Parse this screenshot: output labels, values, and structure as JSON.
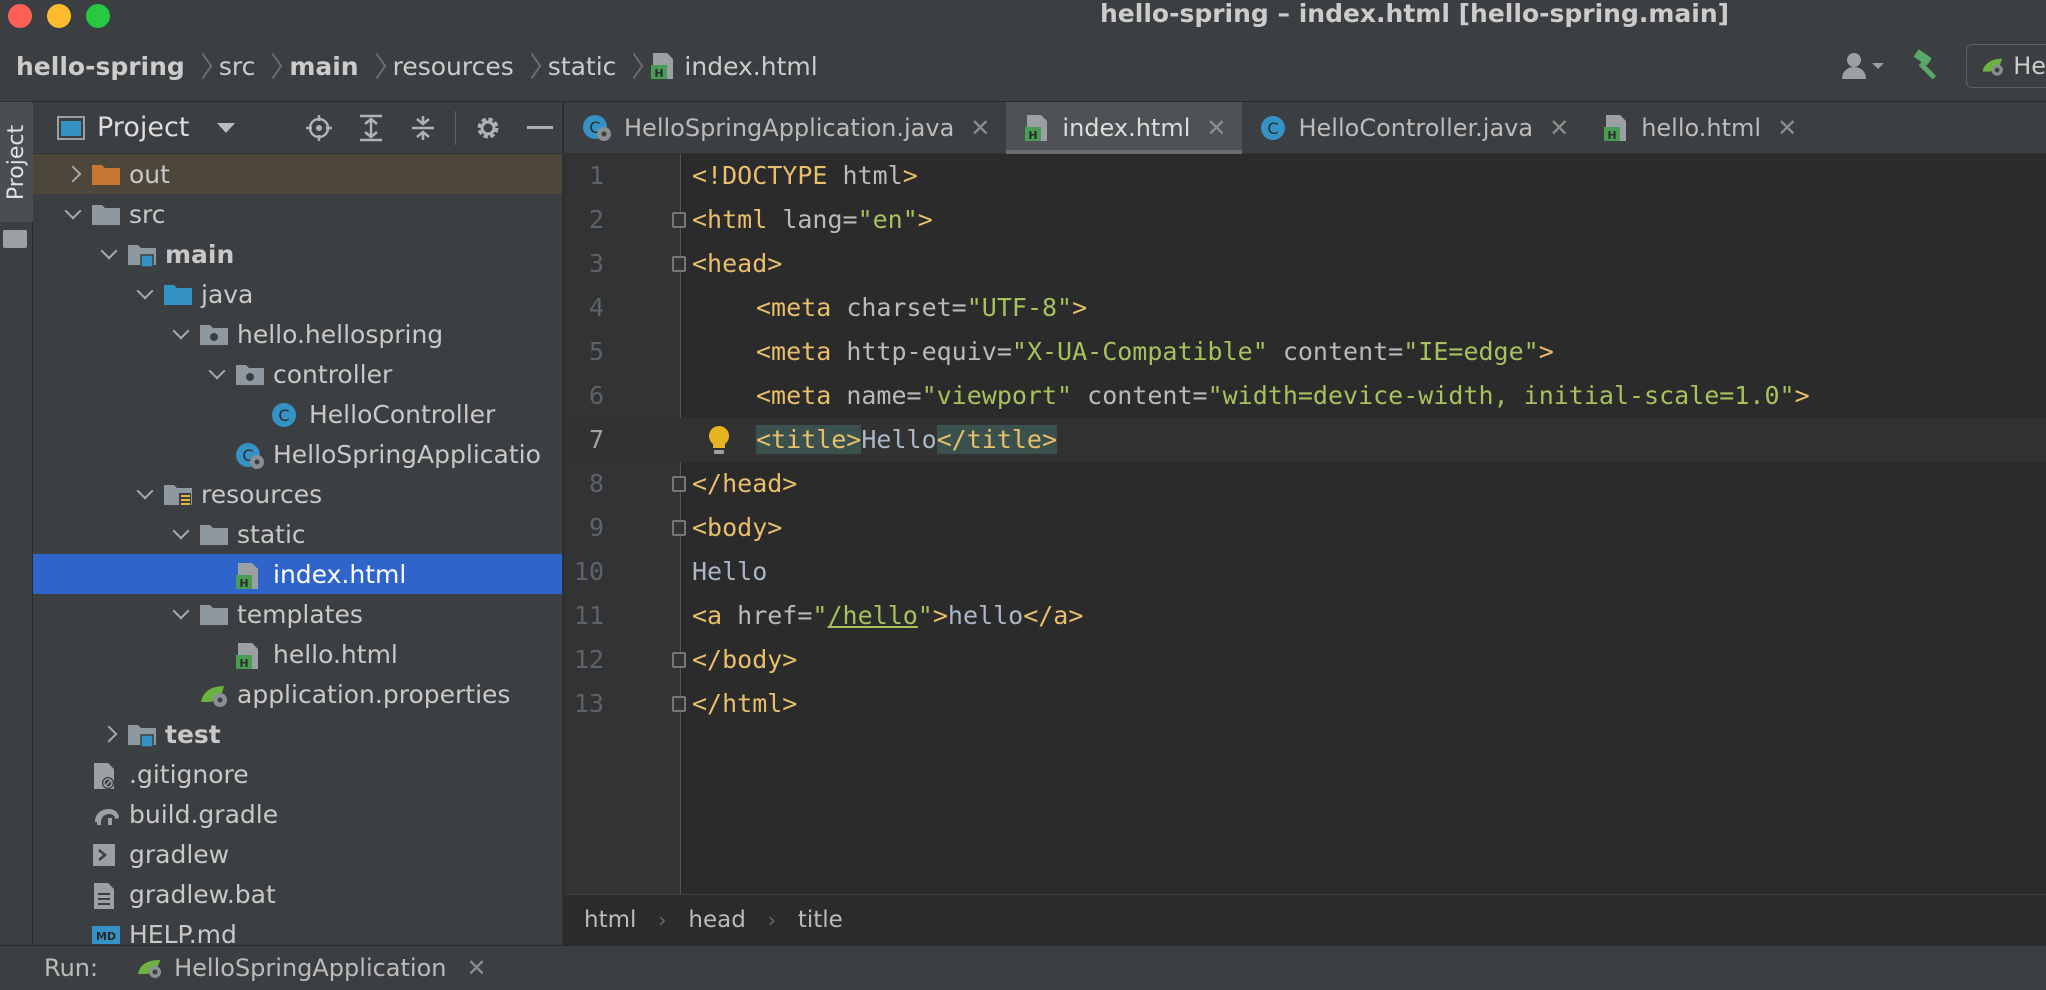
{
  "window": {
    "title": "hello-spring – index.html [hello-spring.main]"
  },
  "navbar": {
    "breadcrumbs": [
      {
        "label": "hello-spring",
        "bold": true
      },
      {
        "label": "src",
        "bold": false
      },
      {
        "label": "main",
        "bold": true
      },
      {
        "label": "resources",
        "bold": false
      },
      {
        "label": "static",
        "bold": false
      },
      {
        "label": "index.html",
        "bold": false
      }
    ],
    "run_config_label": "He"
  },
  "toolstrip": {
    "project_tab": "Project"
  },
  "project_panel": {
    "title": "Project",
    "tree": [
      {
        "label": "out",
        "depth": 1,
        "icon": "folder-excluded-icon",
        "expand": "collapsed",
        "excluded": true
      },
      {
        "label": "src",
        "depth": 1,
        "icon": "folder-icon",
        "expand": "expanded"
      },
      {
        "label": "main",
        "depth": 2,
        "icon": "module-folder-icon",
        "expand": "expanded",
        "bold": true
      },
      {
        "label": "java",
        "depth": 3,
        "icon": "source-folder-icon",
        "expand": "expanded"
      },
      {
        "label": "hello.hellospring",
        "depth": 4,
        "icon": "package-icon",
        "expand": "expanded"
      },
      {
        "label": "controller",
        "depth": 5,
        "icon": "package-icon",
        "expand": "expanded"
      },
      {
        "label": "HelloController",
        "depth": 6,
        "icon": "java-class-icon",
        "expand": "none"
      },
      {
        "label": "HelloSpringApplicatio",
        "depth": 5,
        "icon": "spring-boot-class-icon",
        "expand": "none"
      },
      {
        "label": "resources",
        "depth": 3,
        "icon": "resources-folder-icon",
        "expand": "expanded"
      },
      {
        "label": "static",
        "depth": 4,
        "icon": "folder-icon",
        "expand": "expanded"
      },
      {
        "label": "index.html",
        "depth": 5,
        "icon": "html-file-icon",
        "expand": "none",
        "selected": true
      },
      {
        "label": "templates",
        "depth": 4,
        "icon": "folder-icon",
        "expand": "expanded"
      },
      {
        "label": "hello.html",
        "depth": 5,
        "icon": "html-file-icon",
        "expand": "none"
      },
      {
        "label": "application.properties",
        "depth": 4,
        "icon": "spring-properties-icon",
        "expand": "none"
      },
      {
        "label": "test",
        "depth": 2,
        "icon": "module-folder-icon",
        "expand": "collapsed",
        "bold": true
      },
      {
        "label": ".gitignore",
        "depth": 1,
        "icon": "gitignore-file-icon",
        "expand": "none"
      },
      {
        "label": "build.gradle",
        "depth": 1,
        "icon": "gradle-elephant-icon",
        "expand": "none"
      },
      {
        "label": "gradlew",
        "depth": 1,
        "icon": "shell-script-icon",
        "expand": "none"
      },
      {
        "label": "gradlew.bat",
        "depth": 1,
        "icon": "text-file-icon",
        "expand": "none"
      },
      {
        "label": "HELP.md",
        "depth": 1,
        "icon": "markdown-file-icon",
        "expand": "none"
      }
    ]
  },
  "tabs": [
    {
      "label": "HelloSpringApplication.java",
      "icon": "spring-boot-class-icon",
      "active": false
    },
    {
      "label": "index.html",
      "icon": "html-file-icon",
      "active": true
    },
    {
      "label": "HelloController.java",
      "icon": "java-class-icon",
      "active": false
    },
    {
      "label": "hello.html",
      "icon": "html-file-icon",
      "active": false
    }
  ],
  "editor": {
    "current_line": 7,
    "lines": [
      {
        "n": "1",
        "parts": [
          [
            "tag",
            "<!DOCTYPE "
          ],
          [
            "attr",
            "html"
          ],
          [
            "tag",
            ">"
          ]
        ],
        "indent": 0
      },
      {
        "n": "2",
        "fold": true,
        "parts": [
          [
            "tag",
            "<html "
          ],
          [
            "attr",
            "lang="
          ],
          [
            "val",
            "\"en\""
          ],
          [
            "tag",
            ">"
          ]
        ],
        "indent": 0
      },
      {
        "n": "3",
        "fold": true,
        "parts": [
          [
            "tag",
            "<head>"
          ]
        ],
        "indent": 0
      },
      {
        "n": "4",
        "parts": [
          [
            "tag",
            "<meta "
          ],
          [
            "attr",
            "charset="
          ],
          [
            "val",
            "\"UTF-8\""
          ],
          [
            "tag",
            ">"
          ]
        ],
        "indent": 4
      },
      {
        "n": "5",
        "parts": [
          [
            "tag",
            "<meta "
          ],
          [
            "attr",
            "http-equiv="
          ],
          [
            "val",
            "\"X-UA-Compatible\""
          ],
          [
            "attr",
            " content="
          ],
          [
            "val",
            "\"IE=edge\""
          ],
          [
            "tag",
            ">"
          ]
        ],
        "indent": 4
      },
      {
        "n": "6",
        "parts": [
          [
            "tag",
            "<meta "
          ],
          [
            "attr",
            "name="
          ],
          [
            "val",
            "\"viewport\""
          ],
          [
            "attr",
            " content="
          ],
          [
            "val",
            "\"width=device-width, initial-scale=1.0\""
          ],
          [
            "tag",
            ">"
          ]
        ],
        "indent": 4
      },
      {
        "n": "7",
        "bulb": true,
        "parts": [
          [
            "tag-hl",
            "<title>"
          ],
          [
            "txt",
            "Hello"
          ],
          [
            "tag-hl",
            "</title>"
          ]
        ],
        "indent": 4
      },
      {
        "n": "8",
        "fold": true,
        "parts": [
          [
            "tag",
            "</head>"
          ]
        ],
        "indent": 0
      },
      {
        "n": "9",
        "fold": true,
        "parts": [
          [
            "tag",
            "<body>"
          ]
        ],
        "indent": 0
      },
      {
        "n": "10",
        "parts": [
          [
            "txt",
            "Hello"
          ]
        ],
        "indent": 0
      },
      {
        "n": "11",
        "parts": [
          [
            "tag",
            "<a "
          ],
          [
            "attr",
            "href="
          ],
          [
            "val",
            "\""
          ],
          [
            "link",
            "/hello"
          ],
          [
            "val",
            "\""
          ],
          [
            "tag",
            ">"
          ],
          [
            "txt",
            "hello"
          ],
          [
            "tag",
            "</a>"
          ]
        ],
        "indent": 0
      },
      {
        "n": "12",
        "fold": true,
        "parts": [
          [
            "tag",
            "</body>"
          ]
        ],
        "indent": 0
      },
      {
        "n": "13",
        "fold": true,
        "parts": [
          [
            "tag",
            "</html>"
          ]
        ],
        "indent": 0
      }
    ]
  },
  "editor_breadcrumbs": [
    "html",
    "head",
    "title"
  ],
  "runbar": {
    "label": "Run:",
    "config": "HelloSpringApplication"
  },
  "colors": {
    "selection": "#2f65ca",
    "tag": "#e8bf6a",
    "value": "#a5c25c",
    "excluded_folder": "#c57633"
  }
}
